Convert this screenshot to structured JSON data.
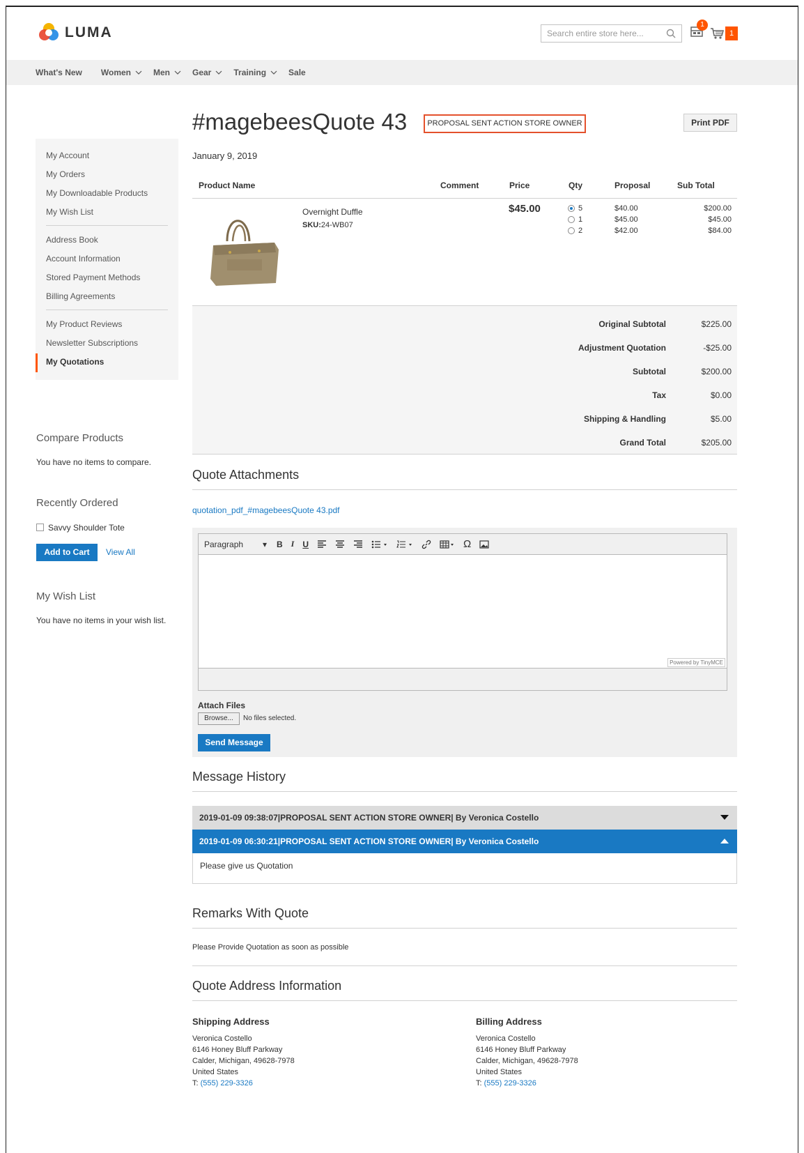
{
  "header": {
    "brand": "LUMA",
    "search_placeholder": "Search entire store here...",
    "quote_badge": "1",
    "cart_count": "1",
    "accent_color": "#ff5501",
    "link_color": "#1979c3"
  },
  "nav": {
    "items": [
      "What's New",
      "Women",
      "Men",
      "Gear",
      "Training",
      "Sale"
    ]
  },
  "sidebar": {
    "group1": [
      "My Account",
      "My Orders",
      "My Downloadable Products",
      "My Wish List"
    ],
    "group2": [
      "Address Book",
      "Account Information",
      "Stored Payment Methods",
      "Billing Agreements"
    ],
    "group3": [
      "My Product Reviews",
      "Newsletter Subscriptions",
      "My Quotations"
    ],
    "compare_title": "Compare Products",
    "compare_text": "You have no items to compare.",
    "recent_title": "Recently Ordered",
    "recent_item": "Savvy Shoulder Tote",
    "add_to_cart": "Add to Cart",
    "view_all": "View All",
    "wishlist_title": "My Wish List",
    "wishlist_text": "You have no items in your wish list."
  },
  "quote": {
    "title": "#magebeesQuote 43",
    "status": "PROPOSAL SENT ACTION STORE OWNER",
    "print_pdf": "Print PDF",
    "date": "January 9, 2019"
  },
  "table": {
    "headers": [
      "Product Name",
      "Comment",
      "Price",
      "Qty",
      "Proposal",
      "Sub Total"
    ],
    "product": {
      "name": "Overnight Duffle",
      "sku_label": "SKU:",
      "sku": "24-WB07",
      "price": "$45.00",
      "tiers": [
        {
          "qty": "5",
          "proposal": "$40.00",
          "subtotal": "$200.00",
          "selected": true
        },
        {
          "qty": "1",
          "proposal": "$45.00",
          "subtotal": "$45.00",
          "selected": false
        },
        {
          "qty": "2",
          "proposal": "$42.00",
          "subtotal": "$84.00",
          "selected": false
        }
      ]
    }
  },
  "totals": [
    {
      "label": "Original Subtotal",
      "value": "$225.00"
    },
    {
      "label": "Adjustment Quotation",
      "value": "-$25.00"
    },
    {
      "label": "Subtotal",
      "value": "$200.00"
    },
    {
      "label": "Tax",
      "value": "$0.00"
    },
    {
      "label": "Shipping & Handling",
      "value": "$5.00"
    },
    {
      "label": "Grand Total",
      "value": "$205.00"
    }
  ],
  "attachments": {
    "title": "Quote Attachments",
    "file": "quotation_pdf_#magebeesQuote 43.pdf"
  },
  "editor": {
    "format": "Paragraph",
    "powered_by": "Powered by TinyMCE",
    "attach_label": "Attach Files",
    "browse": "Browse...",
    "no_file": "No files selected.",
    "send": "Send Message"
  },
  "history": {
    "title": "Message History",
    "entries": [
      {
        "header": "2019-01-09 09:38:07|PROPOSAL SENT ACTION STORE OWNER| By Veronica Costello",
        "expanded": false
      },
      {
        "header": "2019-01-09 06:30:21|PROPOSAL SENT ACTION STORE OWNER| By Veronica Costello",
        "expanded": true,
        "body": "Please give us Quotation"
      }
    ]
  },
  "remarks": {
    "title": "Remarks With Quote",
    "text": "Please Provide Quotation as soon as possible"
  },
  "address": {
    "title": "Quote Address Information",
    "shipping": {
      "heading": "Shipping Address",
      "lines": [
        "Veronica Costello",
        "6146 Honey Bluff Parkway",
        "Calder, Michigan, 49628-7978",
        "United States"
      ],
      "phone_label": "T: ",
      "phone": "(555) 229-3326"
    },
    "billing": {
      "heading": "Billing Address",
      "lines": [
        "Veronica Costello",
        "6146 Honey Bluff Parkway",
        "Calder, Michigan, 49628-7978",
        "United States"
      ],
      "phone_label": "T: ",
      "phone": "(555) 229-3326"
    }
  }
}
